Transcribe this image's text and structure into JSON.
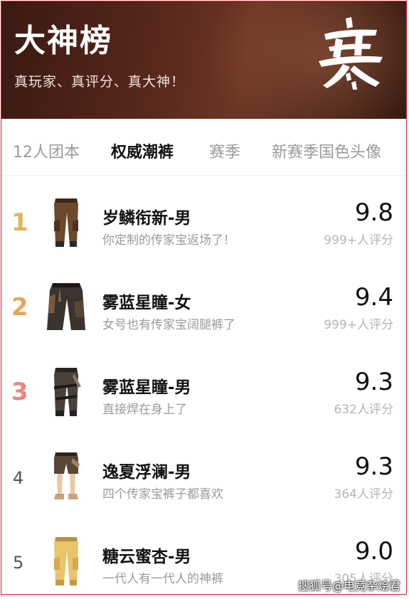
{
  "header": {
    "title": "大神榜",
    "subtitle": "真玩家、真评分、真大神！",
    "logo_icon": "calligraphy-logo"
  },
  "tabs": [
    {
      "label": "12人团本",
      "active": false
    },
    {
      "label": "权威潮裤",
      "active": true
    },
    {
      "label": "赛季",
      "active": false
    },
    {
      "label": "新赛季国色头像",
      "active": false
    }
  ],
  "rows": [
    {
      "rank": "1",
      "rank_color": "#e2b55a",
      "name": "岁鳞衔新-男",
      "desc": "你定制的传家宝返场了！",
      "score": "9.8",
      "count": "999+人评分",
      "icon": "brown-cargo-pants"
    },
    {
      "rank": "2",
      "rank_color": "#e6a65d",
      "name": "雾蓝星瞳-女",
      "desc": "女号也有传家宝阔腿裤了",
      "score": "9.4",
      "count": "999+人评分",
      "icon": "dark-wide-leg-pants"
    },
    {
      "rank": "3",
      "rank_color": "#e8877a",
      "name": "雾蓝星瞳-男",
      "desc": "直接焊在身上了",
      "score": "9.3",
      "count": "632人评分",
      "icon": "dark-strap-pants"
    },
    {
      "rank": "4",
      "rank_color": "#555555",
      "name": "逸夏浮澜-男",
      "desc": "四个传家宝裤子都喜欢",
      "score": "9.3",
      "count": "364人评分",
      "icon": "shorts"
    },
    {
      "rank": "5",
      "rank_color": "#555555",
      "name": "糖云蜜杏-男",
      "desc": "一代人有一代人的神裤",
      "score": "9.0",
      "count": "305人评分",
      "icon": "yellow-cargo-pants"
    }
  ],
  "watermark": "搜狐号@电竞杂烩君",
  "colors": {
    "accent_border": "#d9232a",
    "header_bg": "#4a2117"
  }
}
